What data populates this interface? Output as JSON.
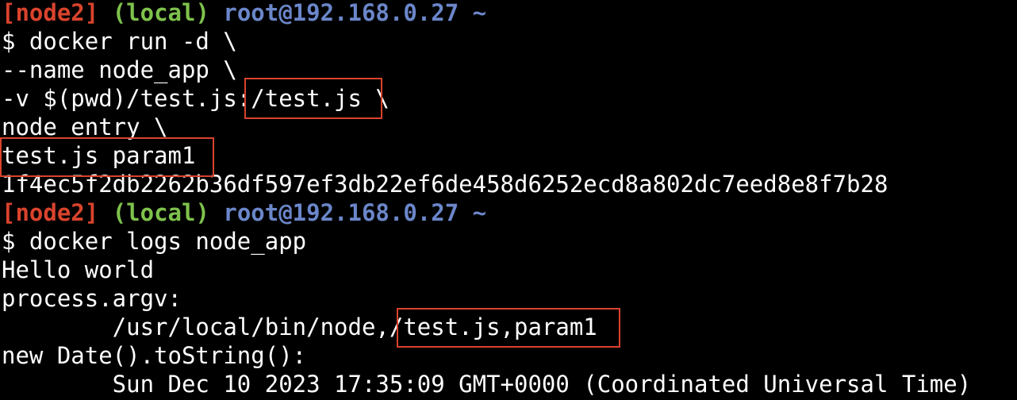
{
  "colors": {
    "background": "#000000",
    "foreground": "#ffffff",
    "node_tag": "#d9432d",
    "local_tag": "#7ec24b",
    "host": "#6b86c9",
    "highlight_box": "#d9432d"
  },
  "prompt1": {
    "node": "[node2]",
    "env": "(local)",
    "host": "root@192.168.0.27 ~"
  },
  "cmd1": {
    "line1": "$ docker run -d \\",
    "line2": "--name node_app \\",
    "line3_a": "-v $(pwd)/test.js",
    "line3_b": ":/test.js",
    "line3_c": " \\",
    "line4": "node entry \\",
    "line5": "test.js param1"
  },
  "container_id": "1f4ec5f2db2262b36df597ef3db22ef6de458d6252ecd8a802dc7eed8e8f7b28",
  "prompt2": {
    "node": "[node2]",
    "env": "(local)",
    "host": "root@192.168.0.27 ~"
  },
  "cmd2": "$ docker logs node_app",
  "output": {
    "hello": "Hello world",
    "argv_label": "process.argv:",
    "argv_prefix": "        /usr/local/bin/node,",
    "argv_highlight": "/test.js,param1",
    "date_label": "new Date().toString():",
    "date_value": "        Sun Dec 10 2023 17:35:09 GMT+0000 (Coordinated Universal Time)"
  }
}
